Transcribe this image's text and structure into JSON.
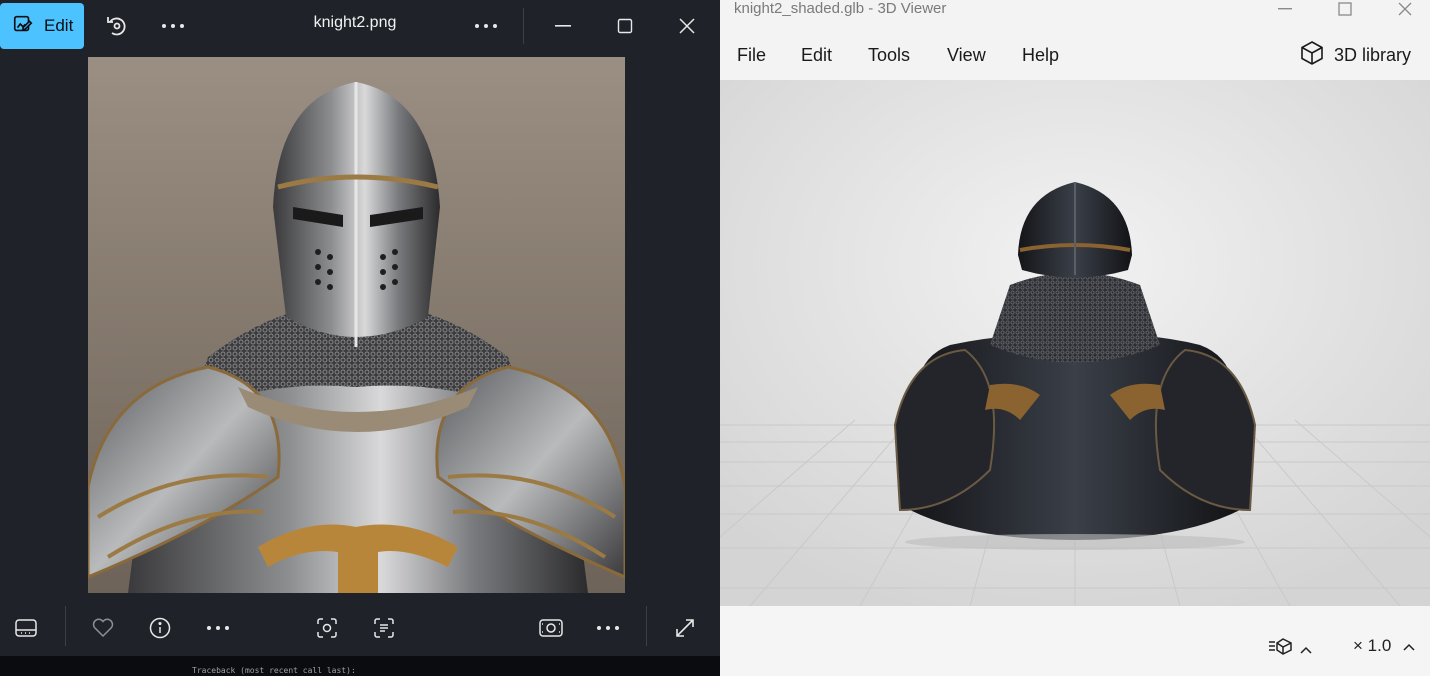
{
  "photos": {
    "edit_label": "Edit",
    "file_name": "knight2.png",
    "icons": {
      "edit": "edit-image-icon",
      "rotate": "rotate-icon",
      "more": "more-icon",
      "minimize": "minimize-icon",
      "maximize": "maximize-icon",
      "close": "close-icon",
      "filmstrip": "filmstrip-icon",
      "favorite": "heart-icon",
      "info": "info-icon",
      "visual_search": "visual-search-icon",
      "text_scan": "scan-text-icon",
      "slideshow": "slideshow-icon",
      "fullscreen": "fullscreen-icon"
    },
    "accent": "#4cc2ff"
  },
  "terminal": {
    "text": "Traceback (most recent call last):"
  },
  "viewer": {
    "title": "knight2_shaded.glb - 3D Viewer",
    "menu": [
      "File",
      "Edit",
      "Tools",
      "View",
      "Help"
    ],
    "library_label": "3D library",
    "zoom_label": "× 1.0",
    "icons": {
      "library": "cube-icon",
      "environment": "environment-lighting-icon",
      "chevron": "chevron-up-icon"
    }
  }
}
